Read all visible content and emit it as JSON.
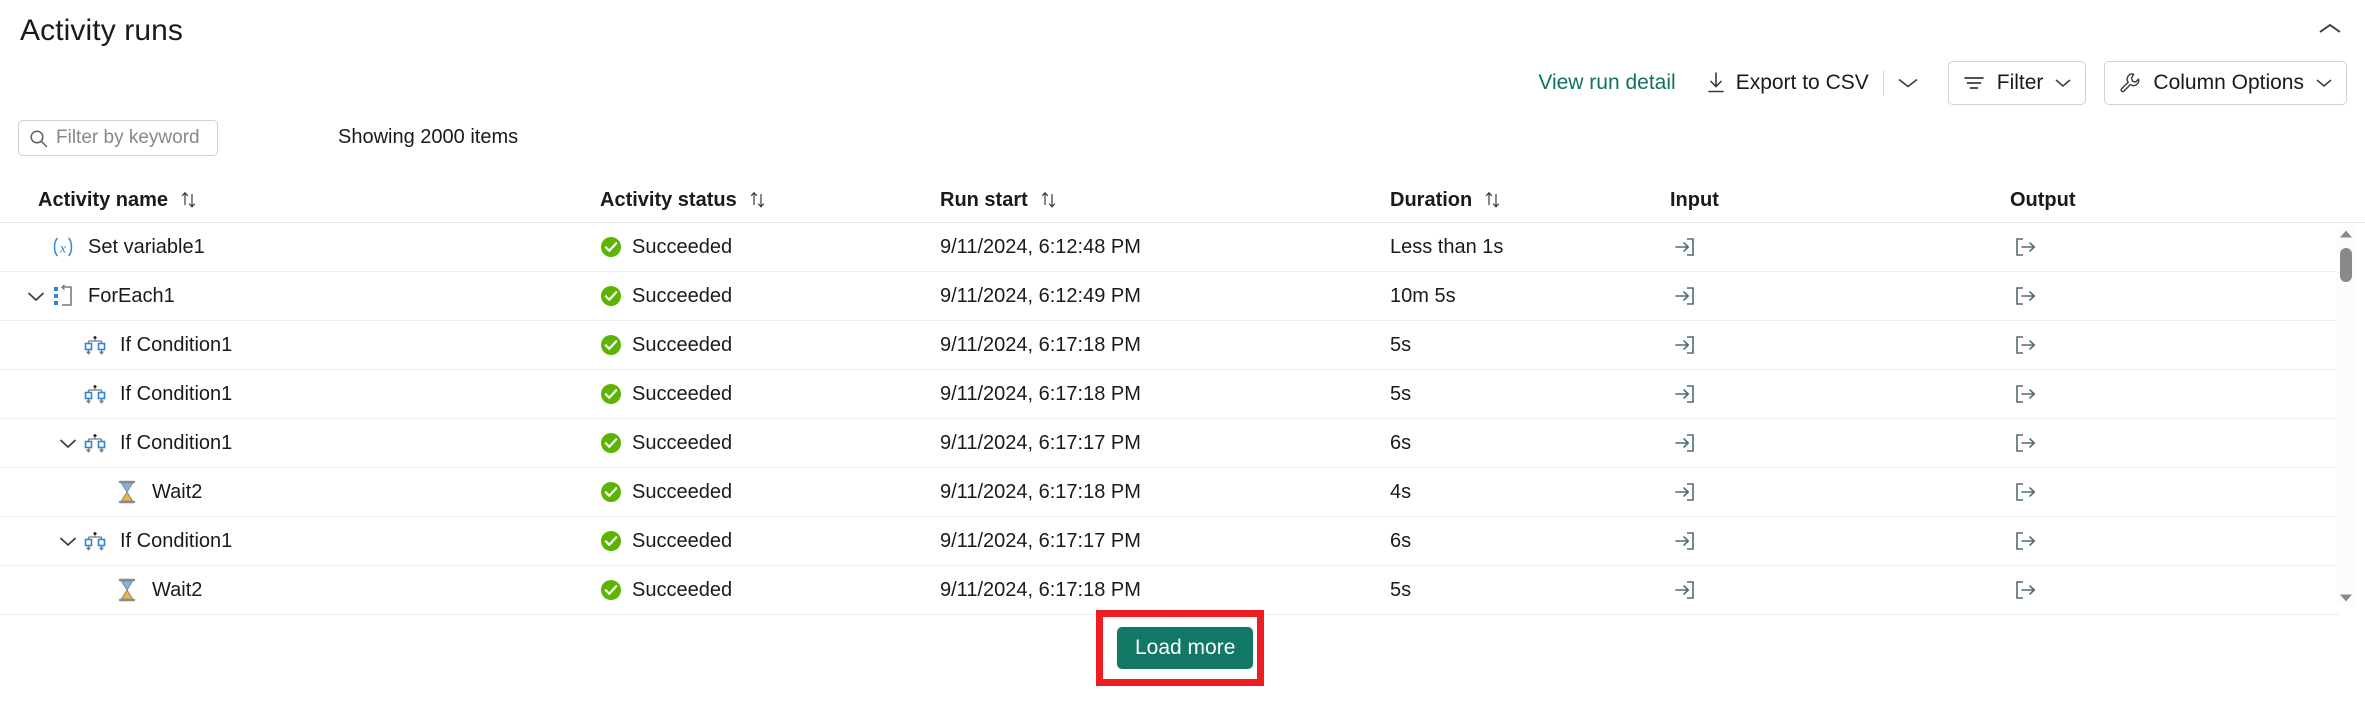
{
  "header": {
    "title": "Activity runs",
    "collapse_icon": "chevron-up-icon"
  },
  "commandbar": {
    "view_run_detail": "View run detail",
    "export_csv": "Export to CSV",
    "export_icon": "download-icon",
    "export_caret_icon": "chevron-down-icon",
    "filter": "Filter",
    "filter_icon": "filter-icon",
    "filter_caret_icon": "chevron-down-icon",
    "column_options": "Column Options",
    "column_options_icon": "wrench-icon",
    "column_options_caret_icon": "chevron-down-icon"
  },
  "filterbar": {
    "search_placeholder": "Filter by keyword",
    "search_value": "",
    "search_icon": "search-icon",
    "showing": "Showing 2000 items"
  },
  "table": {
    "columns": [
      {
        "label": "Activity name",
        "sortable": true,
        "sort_icon": "sort-arrows-icon"
      },
      {
        "label": "Activity status",
        "sortable": true,
        "sort_icon": "sort-arrows-icon"
      },
      {
        "label": "Run start",
        "sortable": true,
        "sort_icon": "sort-arrows-icon"
      },
      {
        "label": "Duration",
        "sortable": true,
        "sort_icon": "sort-arrows-icon"
      },
      {
        "label": "Input",
        "sortable": false,
        "sort_icon": ""
      },
      {
        "label": "Output",
        "sortable": false,
        "sort_icon": ""
      }
    ],
    "rows": [
      {
        "name": "Set variable1",
        "icon": "set-variable-icon",
        "indent": 0,
        "expandable": false,
        "expanded": false,
        "status": "Succeeded",
        "status_icon": "success-check-icon",
        "run_start": "9/11/2024, 6:12:48 PM",
        "duration": "Less than 1s",
        "input_icon": "arrow-into-bracket-icon",
        "output_icon": "arrow-out-of-bracket-icon"
      },
      {
        "name": "ForEach1",
        "icon": "foreach-icon",
        "indent": 0,
        "expandable": true,
        "expanded": true,
        "status": "Succeeded",
        "status_icon": "success-check-icon",
        "run_start": "9/11/2024, 6:12:49 PM",
        "duration": "10m 5s",
        "input_icon": "arrow-into-bracket-icon",
        "output_icon": "arrow-out-of-bracket-icon"
      },
      {
        "name": "If Condition1",
        "icon": "if-condition-icon",
        "indent": 1,
        "expandable": false,
        "expanded": false,
        "status": "Succeeded",
        "status_icon": "success-check-icon",
        "run_start": "9/11/2024, 6:17:18 PM",
        "duration": "5s",
        "input_icon": "arrow-into-bracket-icon",
        "output_icon": "arrow-out-of-bracket-icon"
      },
      {
        "name": "If Condition1",
        "icon": "if-condition-icon",
        "indent": 1,
        "expandable": false,
        "expanded": false,
        "status": "Succeeded",
        "status_icon": "success-check-icon",
        "run_start": "9/11/2024, 6:17:18 PM",
        "duration": "5s",
        "input_icon": "arrow-into-bracket-icon",
        "output_icon": "arrow-out-of-bracket-icon"
      },
      {
        "name": "If Condition1",
        "icon": "if-condition-icon",
        "indent": 1,
        "expandable": true,
        "expanded": true,
        "status": "Succeeded",
        "status_icon": "success-check-icon",
        "run_start": "9/11/2024, 6:17:17 PM",
        "duration": "6s",
        "input_icon": "arrow-into-bracket-icon",
        "output_icon": "arrow-out-of-bracket-icon"
      },
      {
        "name": "Wait2",
        "icon": "hourglass-icon",
        "indent": 2,
        "expandable": false,
        "expanded": false,
        "status": "Succeeded",
        "status_icon": "success-check-icon",
        "run_start": "9/11/2024, 6:17:18 PM",
        "duration": "4s",
        "input_icon": "arrow-into-bracket-icon",
        "output_icon": "arrow-out-of-bracket-icon"
      },
      {
        "name": "If Condition1",
        "icon": "if-condition-icon",
        "indent": 1,
        "expandable": true,
        "expanded": true,
        "status": "Succeeded",
        "status_icon": "success-check-icon",
        "run_start": "9/11/2024, 6:17:17 PM",
        "duration": "6s",
        "input_icon": "arrow-into-bracket-icon",
        "output_icon": "arrow-out-of-bracket-icon"
      },
      {
        "name": "Wait2",
        "icon": "hourglass-icon",
        "indent": 2,
        "expandable": false,
        "expanded": false,
        "status": "Succeeded",
        "status_icon": "success-check-icon",
        "run_start": "9/11/2024, 6:17:18 PM",
        "duration": "5s",
        "input_icon": "arrow-into-bracket-icon",
        "output_icon": "arrow-out-of-bracket-icon"
      }
    ]
  },
  "footer": {
    "load_more": "Load more"
  },
  "scrollbar": {
    "up_icon": "triangle-up-icon",
    "down_icon": "triangle-down-icon"
  },
  "colors": {
    "accent_teal": "#117865",
    "link_teal": "#12715e",
    "success_green": "#5cb300",
    "highlight_red": "#ee1d24",
    "activity_blue": "#2b88d8",
    "border": "#e8e8e8"
  }
}
